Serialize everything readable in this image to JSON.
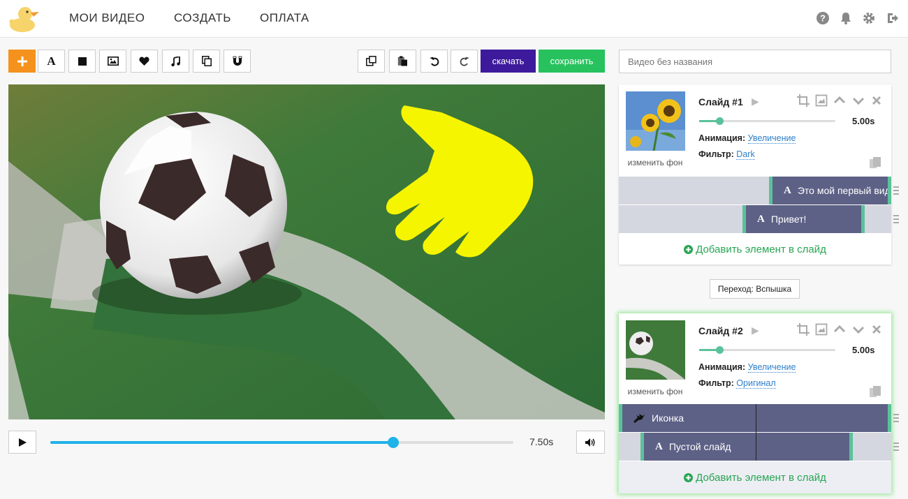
{
  "nav": {
    "items": [
      "МОИ ВИДЕО",
      "СОЗДАТЬ",
      "ОПЛАТА"
    ],
    "right_icons": [
      "help-icon",
      "bell-icon",
      "gear-icon",
      "logout-icon"
    ]
  },
  "toolbar": {
    "left_icons": [
      "plus-icon",
      "text-icon",
      "square-icon",
      "image-icon",
      "heart-icon",
      "music-icon",
      "copy-icon",
      "magnet-icon"
    ],
    "right_icons": [
      "duplicate-icon",
      "paste-icon",
      "undo-icon",
      "redo-icon"
    ],
    "download_label": "скачать",
    "save_label": "сохранить"
  },
  "project": {
    "title_placeholder": "Видео без названия"
  },
  "player": {
    "time": "7.50s",
    "progress": 0.74
  },
  "slides": [
    {
      "title": "Слайд #1",
      "duration": "5.00s",
      "duration_level": 0.15,
      "animation_label": "Анимация:",
      "animation": "Увеличение",
      "filter_label": "Фильтр:",
      "filter": "Dark",
      "change_bg": "изменить фон",
      "elements": [
        {
          "type": "text",
          "label": "Это мой первый видеоролик"
        },
        {
          "type": "text",
          "label": "Привет!"
        }
      ],
      "add_element": "Добавить элемент в слайд"
    },
    {
      "title": "Слайд #2",
      "duration": "5.00s",
      "duration_level": 0.15,
      "animation_label": "Анимация:",
      "animation": "Увеличение",
      "filter_label": "Фильтр:",
      "filter": "Оригинал",
      "change_bg": "изменить фон",
      "elements": [
        {
          "type": "icon",
          "label": "Иконка"
        },
        {
          "type": "text",
          "label": "Пустой слайд"
        }
      ],
      "add_element": "Добавить элемент в слайд"
    }
  ],
  "transition": {
    "label": "Переход: Вспышка"
  },
  "colors": {
    "accent_orange": "#f4921d",
    "download": "#3d1a9b",
    "save": "#27c25e",
    "timeline": "#1fb3e8",
    "clip": "#5d6186",
    "clip_edge": "#5bc19b",
    "add": "#29a553"
  }
}
